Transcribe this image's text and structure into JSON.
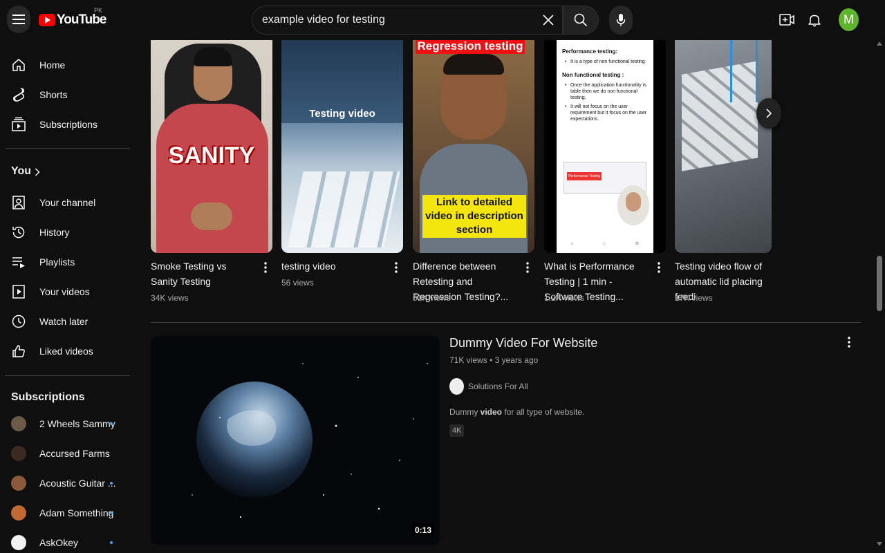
{
  "header": {
    "logo_text": "YouTube",
    "region": "PK",
    "search_value": "example video for testing",
    "avatar_letter": "M"
  },
  "sidebar": {
    "main": [
      {
        "label": "Home",
        "icon": "home-icon"
      },
      {
        "label": "Shorts",
        "icon": "shorts-icon"
      },
      {
        "label": "Subscriptions",
        "icon": "subscriptions-icon"
      }
    ],
    "you_label": "You",
    "you_items": [
      {
        "label": "Your channel",
        "icon": "channel-icon"
      },
      {
        "label": "History",
        "icon": "history-icon"
      },
      {
        "label": "Playlists",
        "icon": "playlists-icon"
      },
      {
        "label": "Your videos",
        "icon": "your-videos-icon"
      },
      {
        "label": "Watch later",
        "icon": "clock-icon"
      },
      {
        "label": "Liked videos",
        "icon": "thumbs-up-icon"
      }
    ],
    "subscriptions_label": "Subscriptions",
    "subscriptions": [
      {
        "label": "2 Wheels Sammy",
        "new": true,
        "color": "#6b5a48"
      },
      {
        "label": "Accursed Farms",
        "new": false,
        "color": "#3a2a22"
      },
      {
        "label": "Acoustic Guitar ...",
        "new": true,
        "color": "#8a5a3a"
      },
      {
        "label": "Adam Something",
        "new": true,
        "color": "#c06a32"
      },
      {
        "label": "AskOkey",
        "new": true,
        "color": "#f2f2f2"
      }
    ]
  },
  "shorts": [
    {
      "title": "Smoke Testing vs Sanity Testing",
      "views": "34K views",
      "overlay": "SANITY"
    },
    {
      "title": "testing video",
      "views": "56 views",
      "overlay": "Testing video"
    },
    {
      "title": "Difference between Retesting and Regression Testing?...",
      "views": "51K views",
      "overlay_top": "Regression testing",
      "overlay_bottom": "Link to detailed video in description section"
    },
    {
      "title": "What is Performance Testing | 1 min - Software Testing...",
      "views": "1.2K views",
      "overlay_heading1": "Performance testing:",
      "overlay_bullet1": "It is a type of non functional testing",
      "overlay_heading2": "Non functional testing :",
      "overlay_bullet2": "Once the application functionality is table then we do non functional testing.",
      "overlay_bullet3": "It will not focus on the user requirement but it focus on the user expectations.",
      "overlay_box": "Performance Testing"
    },
    {
      "title": "Testing video flow of automatic lid placing feedi",
      "views": "17K views"
    }
  ],
  "result": {
    "title": "Dummy Video For Website",
    "views": "71K views",
    "age": "3 years ago",
    "channel": "Solutions For All",
    "desc_pre": "Dummy ",
    "desc_bold": "video",
    "desc_post": " for all type of website.",
    "badge": "4K",
    "duration": "0:13"
  },
  "colors": {
    "background": "#0f0f0f",
    "brand_red": "#ff0000",
    "avatar_green": "#5fb32d",
    "new_dot": "#3ea6ff"
  }
}
